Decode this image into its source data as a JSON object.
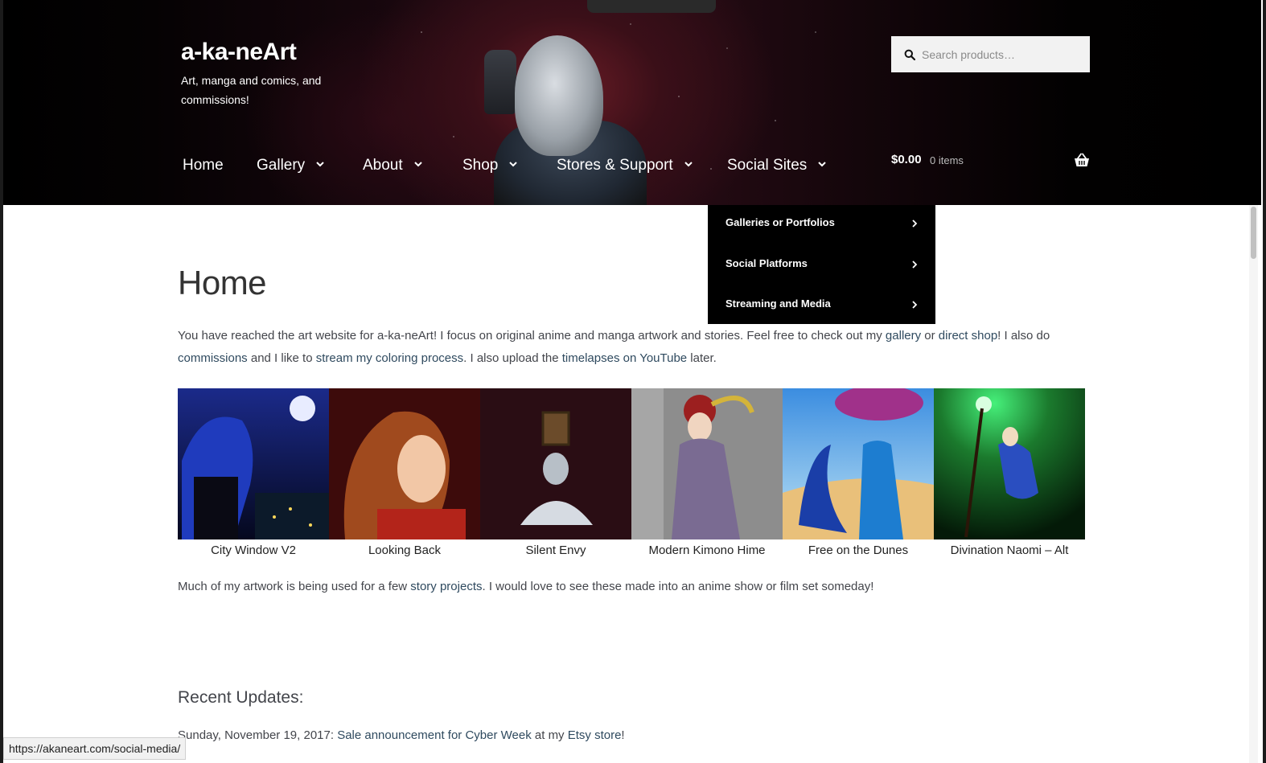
{
  "site": {
    "title": "a-ka-neArt",
    "description": "Art, manga and comics, and commissions!"
  },
  "search": {
    "placeholder": "Search products…"
  },
  "nav": {
    "items": [
      {
        "label": "Home",
        "has_dropdown": false
      },
      {
        "label": "Gallery",
        "has_dropdown": true
      },
      {
        "label": "About",
        "has_dropdown": true
      },
      {
        "label": "Shop",
        "has_dropdown": true
      },
      {
        "label": "Stores & Support",
        "has_dropdown": true
      },
      {
        "label": "Social Sites",
        "has_dropdown": true
      }
    ]
  },
  "cart": {
    "amount": "$0.00",
    "count": "0 items"
  },
  "dropdown": {
    "items": [
      {
        "label": "Galleries or Portfolios"
      },
      {
        "label": "Social Platforms"
      },
      {
        "label": "Streaming and Media"
      }
    ]
  },
  "main": {
    "page_title": "Home",
    "intro": {
      "t1": "You have reached the art website for a-ka-neArt!  I focus on original anime and manga artwork and stories.  Feel free to check out my ",
      "l1": "gallery",
      "t2": " or ",
      "l2": "direct shop",
      "t3": "!  I also do ",
      "l3": "commissions",
      "t4": " and I like to ",
      "l4": "stream my coloring process",
      "t5": ".  I also upload the ",
      "l5": "timelapses on YouTube",
      "t6": " later."
    },
    "gallery": [
      {
        "caption": "City Window V2",
        "icon": "artwork-city-window"
      },
      {
        "caption": "Looking Back",
        "icon": "artwork-looking-back"
      },
      {
        "caption": "Silent Envy",
        "icon": "artwork-silent-envy"
      },
      {
        "caption": "Modern Kimono Hime",
        "icon": "artwork-kimono"
      },
      {
        "caption": "Free on the Dunes",
        "icon": "artwork-dunes"
      },
      {
        "caption": "Divination Naomi – Alt",
        "icon": "artwork-divination"
      }
    ],
    "para2": {
      "t1": "Much of my artwork is being used for a few ",
      "l1": "story projects",
      "t2": ".  I would love to see these made into an anime show or film set someday!"
    },
    "recent_title": "Recent Updates:",
    "recent": {
      "t1": "Sunday, November 19, 2017: ",
      "l1": "Sale announcement for Cyber Week",
      "t2": " at my ",
      "l2": "Etsy store",
      "t3": "!"
    }
  },
  "status_bar": {
    "url": "https://akaneart.com/social-media/"
  },
  "colors": {
    "header_bg": "#000000",
    "link": "#2f4a5f",
    "dropdown_bg": "#000000"
  }
}
